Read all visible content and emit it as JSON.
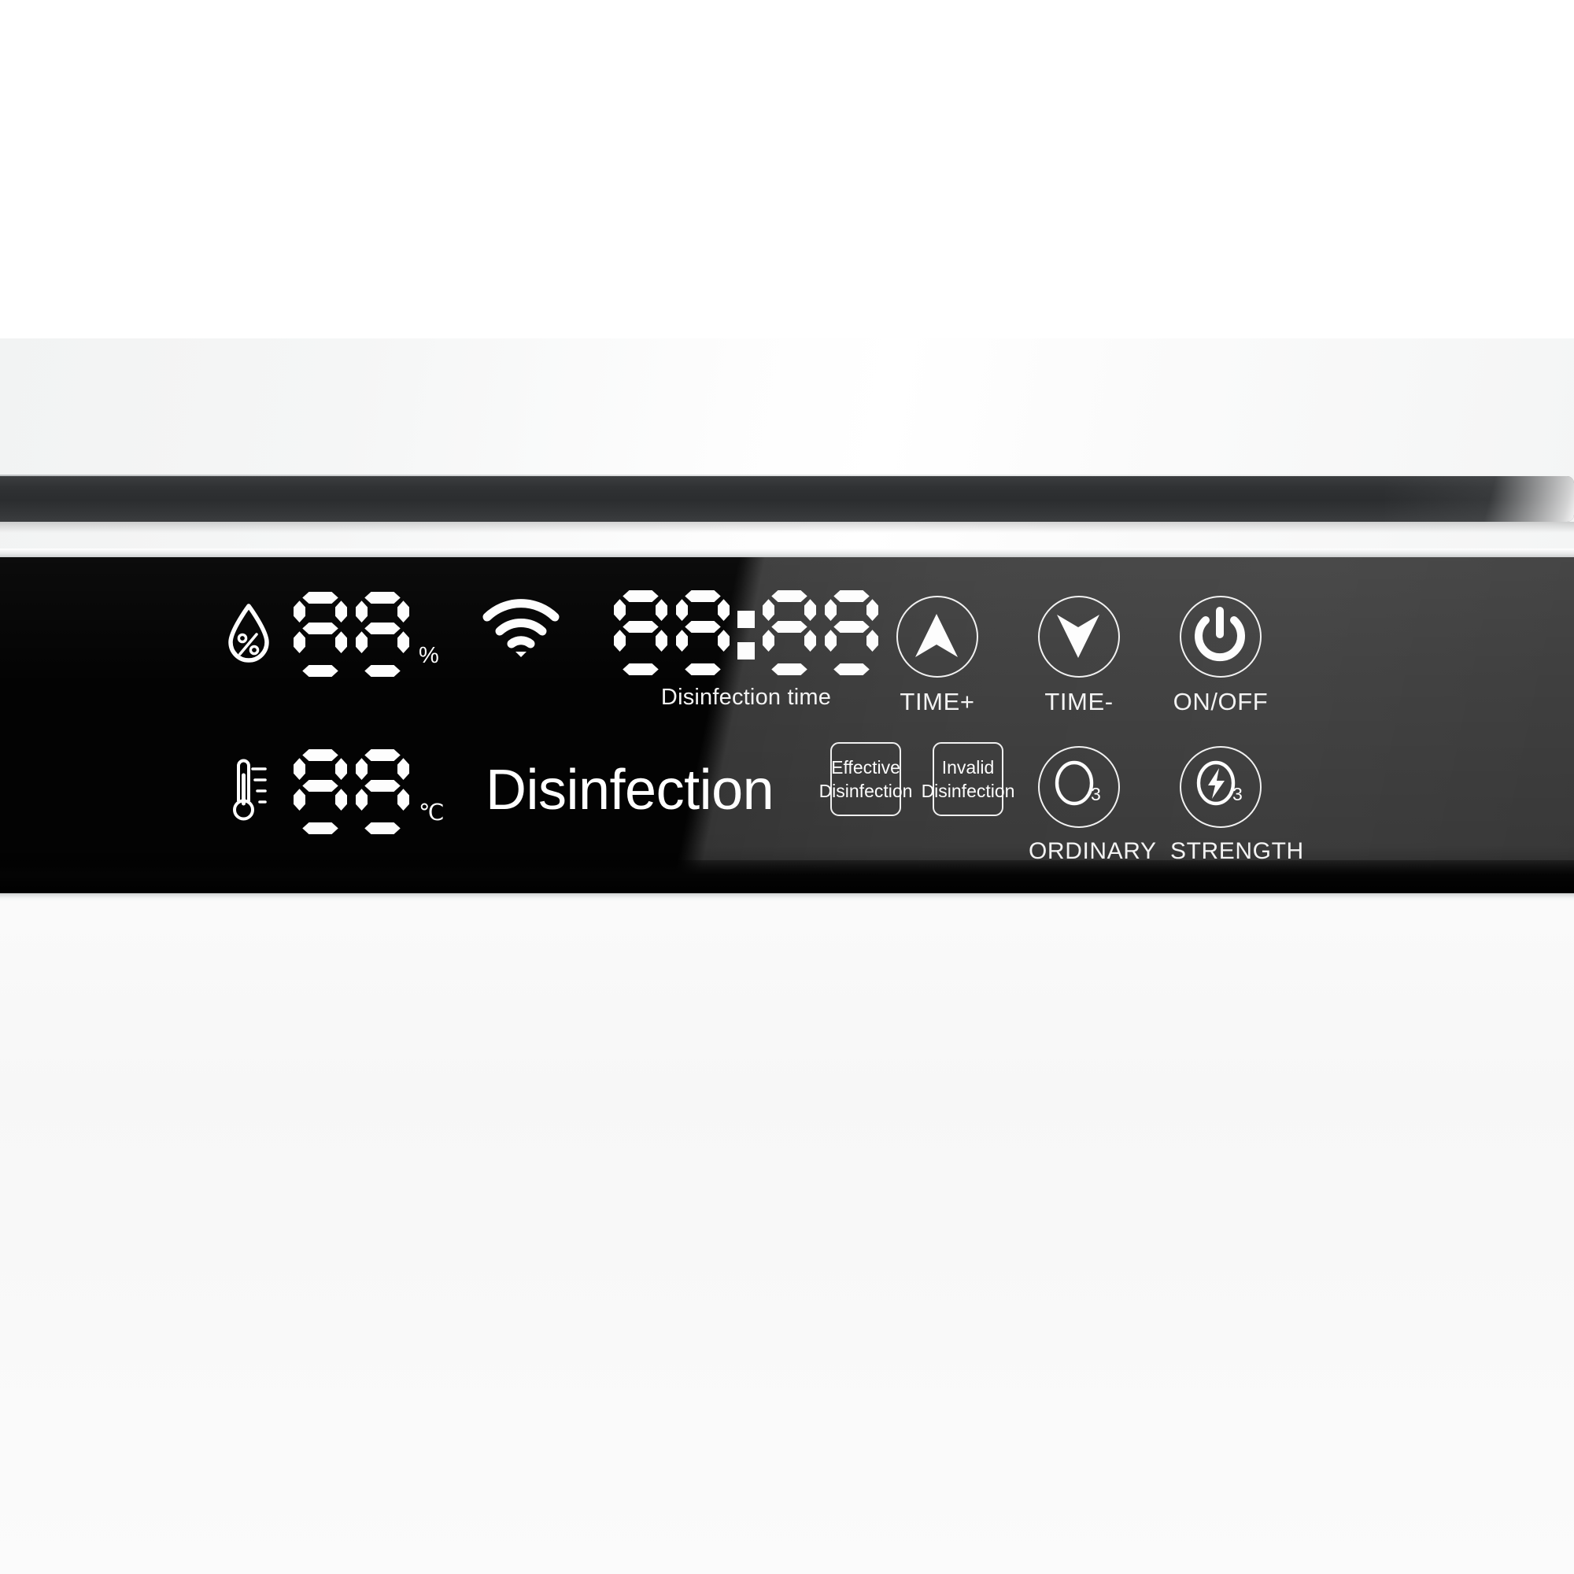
{
  "device": {
    "panel_background": "#030303",
    "accent": "#ffffff",
    "body_color": "#f7f8f8"
  },
  "display": {
    "humidity": {
      "icon": "water-drop-percent-icon",
      "value": "88",
      "unit": "%"
    },
    "temperature": {
      "icon": "thermometer-icon",
      "value": "88",
      "unit": "℃"
    },
    "wifi": {
      "icon": "wifi-icon",
      "bars": 3,
      "state": "connected"
    },
    "timer": {
      "hours": "88",
      "minutes": "88",
      "separator": ":",
      "caption": "Disinfection time"
    },
    "status_text": "Disinfection"
  },
  "status_pads": [
    {
      "name": "effective-disinfection",
      "line1": "Effective",
      "line2": "Disinfection"
    },
    {
      "name": "invalid-disinfection",
      "line1": "Invalid",
      "line2": "Disinfection"
    }
  ],
  "buttons": {
    "time_plus": {
      "label": "TIME+",
      "icon": "arrow-up-icon"
    },
    "time_minus": {
      "label": "TIME-",
      "icon": "arrow-down-icon"
    },
    "power": {
      "label": "ON/OFF",
      "icon": "power-icon"
    },
    "ordinary": {
      "label": "ORDINARY",
      "icon": "ozone-icon",
      "sub": "3"
    },
    "strength": {
      "label": "STRENGTH",
      "icon": "ozone-lightning-icon",
      "sub": "3"
    }
  }
}
